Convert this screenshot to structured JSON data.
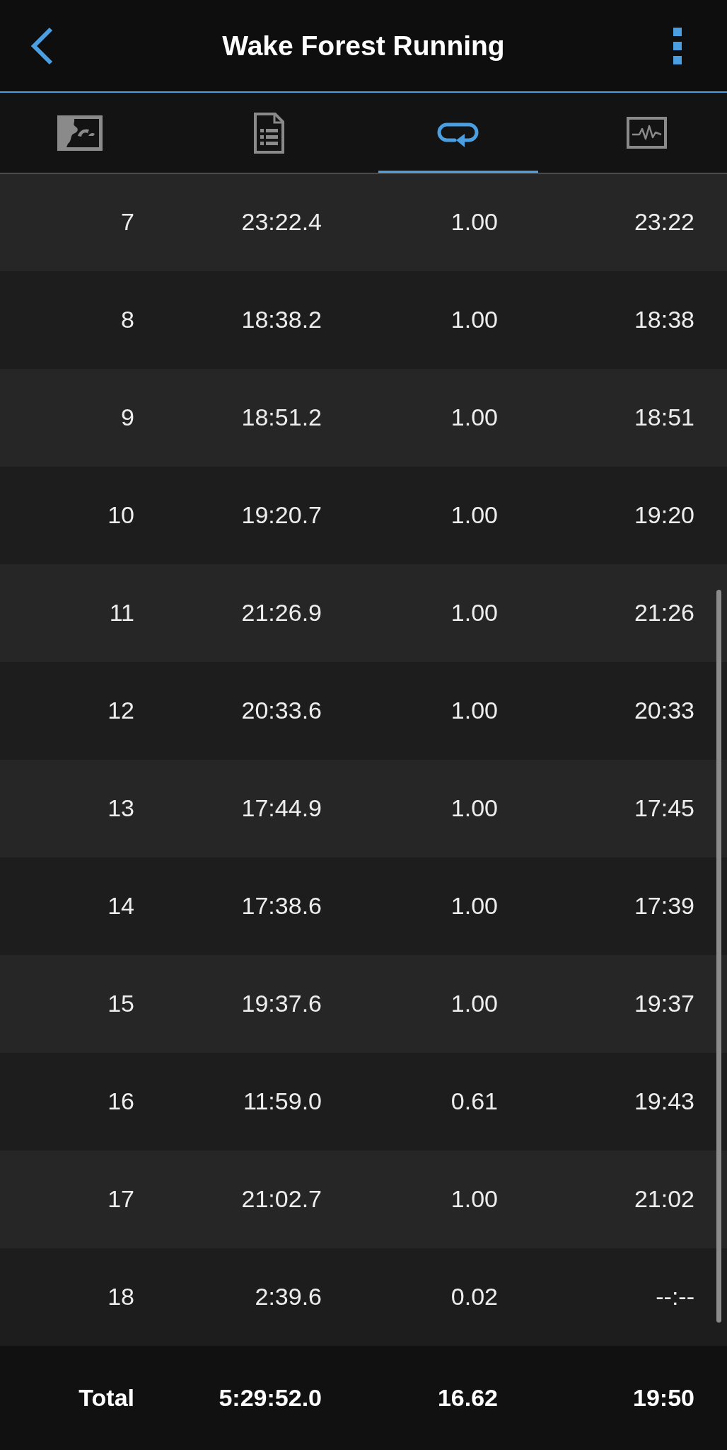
{
  "header": {
    "title": "Wake Forest Running"
  },
  "tabs": [
    {
      "kind": "map",
      "selected": false
    },
    {
      "kind": "document",
      "selected": false
    },
    {
      "kind": "loop",
      "selected": true
    },
    {
      "kind": "pulse",
      "selected": false
    }
  ],
  "laps": {
    "rows": [
      {
        "cells": [
          "7",
          "23:22.4",
          "1.00",
          "23:22"
        ]
      },
      {
        "cells": [
          "8",
          "18:38.2",
          "1.00",
          "18:38"
        ]
      },
      {
        "cells": [
          "9",
          "18:51.2",
          "1.00",
          "18:51"
        ]
      },
      {
        "cells": [
          "10",
          "19:20.7",
          "1.00",
          "19:20"
        ]
      },
      {
        "cells": [
          "11",
          "21:26.9",
          "1.00",
          "21:26"
        ]
      },
      {
        "cells": [
          "12",
          "20:33.6",
          "1.00",
          "20:33"
        ]
      },
      {
        "cells": [
          "13",
          "17:44.9",
          "1.00",
          "17:45"
        ]
      },
      {
        "cells": [
          "14",
          "17:38.6",
          "1.00",
          "17:39"
        ]
      },
      {
        "cells": [
          "15",
          "19:37.6",
          "1.00",
          "19:37"
        ]
      },
      {
        "cells": [
          "16",
          "11:59.0",
          "0.61",
          "19:43"
        ]
      },
      {
        "cells": [
          "17",
          "21:02.7",
          "1.00",
          "21:02"
        ]
      },
      {
        "cells": [
          "18",
          "2:39.6",
          "0.02",
          "--:--"
        ]
      }
    ],
    "total": {
      "cells": [
        "Total",
        "5:29:52.0",
        "16.62",
        "19:50"
      ]
    }
  }
}
